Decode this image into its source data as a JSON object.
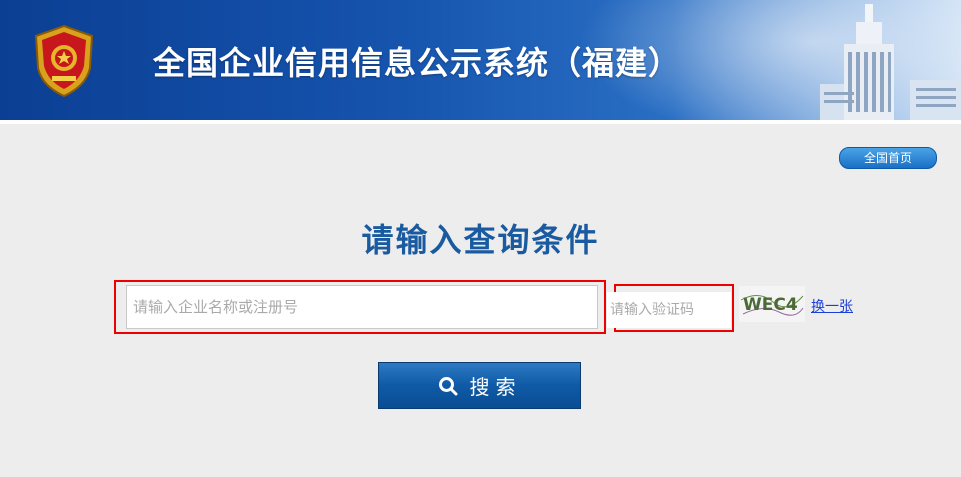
{
  "header": {
    "title": "全国企业信用信息公示系统（福建）"
  },
  "nav": {
    "home_label": "全国首页"
  },
  "main": {
    "heading": "请输入查询条件",
    "name_input": {
      "placeholder": "请输入企业名称或注册号",
      "value": ""
    },
    "captcha_input": {
      "placeholder": "请输入验证码",
      "value": ""
    },
    "captcha_image_text": "WEC4",
    "refresh_label": "换一张",
    "search_label": "搜索"
  },
  "colors": {
    "banner": "#1553ad",
    "heading": "#1a5aa0",
    "highlight": "#ee0000",
    "link": "#1a3fd6"
  }
}
